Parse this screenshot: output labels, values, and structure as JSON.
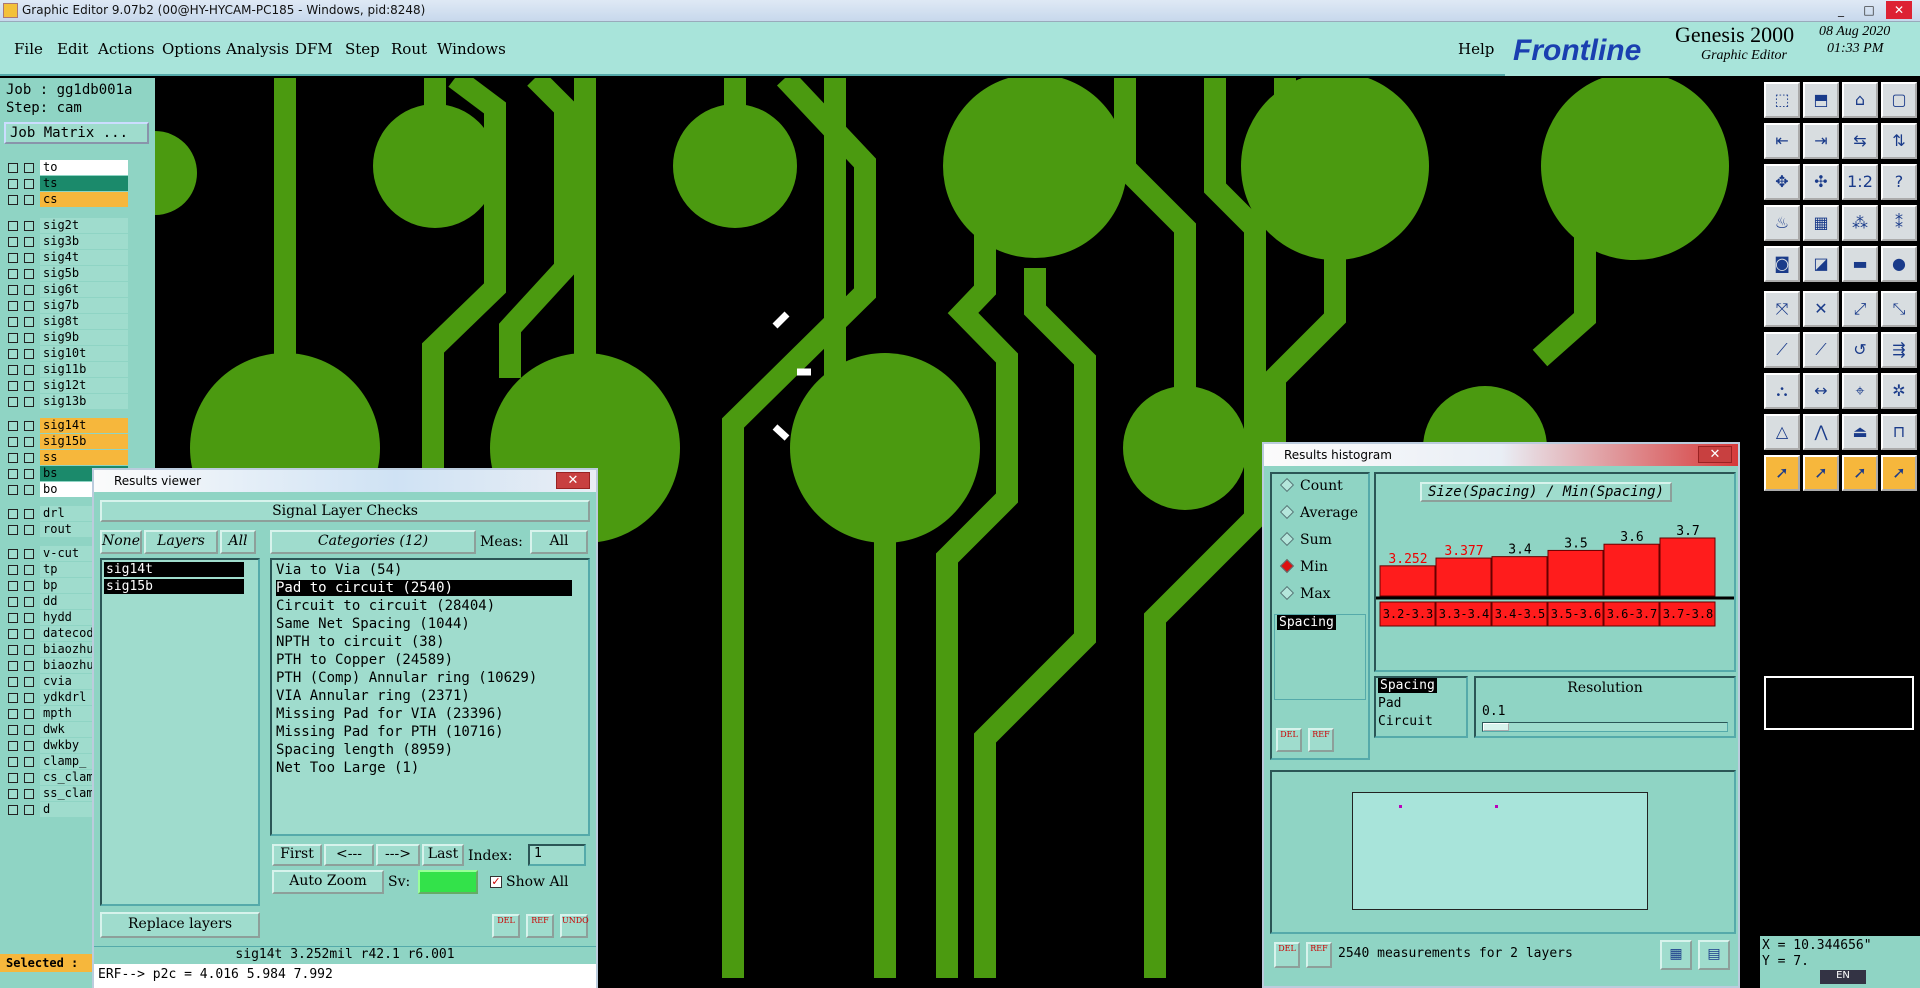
{
  "app": {
    "title": "Graphic Editor 9.07b2 (00@HY-HYCAM-PC185 - Windows, pid:8248)",
    "min": "_",
    "max": "□",
    "close": "✕"
  },
  "menu": {
    "items": [
      "File",
      "Edit",
      "Actions",
      "Options",
      "Analysis",
      "DFM",
      "Step",
      "Rout",
      "Windows"
    ],
    "help": "Help"
  },
  "brand": {
    "logo": "Frontline",
    "product": "Genesis 2000",
    "subtitle": "Graphic Editor",
    "date": "08 Aug 2020",
    "time": "01:33 PM"
  },
  "job": {
    "job_line": "Job : gg1db001a",
    "step_line": "Step: cam",
    "matrix_button": "Job Matrix ..."
  },
  "layers": [
    {
      "name": "to",
      "color": "#ffffff"
    },
    {
      "name": "ts",
      "color": "#1b8a6b"
    },
    {
      "name": "cs",
      "color": "#f6b73c"
    },
    {
      "name": "sig2t",
      "color": "#9fdccd"
    },
    {
      "name": "sig3b",
      "color": "#9fdccd"
    },
    {
      "name": "sig4t",
      "color": "#9fdccd"
    },
    {
      "name": "sig5b",
      "color": "#9fdccd"
    },
    {
      "name": "sig6t",
      "color": "#9fdccd"
    },
    {
      "name": "sig7b",
      "color": "#9fdccd"
    },
    {
      "name": "sig8t",
      "color": "#9fdccd"
    },
    {
      "name": "sig9b",
      "color": "#9fdccd"
    },
    {
      "name": "sig10t",
      "color": "#9fdccd"
    },
    {
      "name": "sig11b",
      "color": "#9fdccd"
    },
    {
      "name": "sig12t",
      "color": "#9fdccd"
    },
    {
      "name": "sig13b",
      "color": "#9fdccd"
    },
    {
      "name": "sig14t",
      "color": "#f6b73c"
    },
    {
      "name": "sig15b",
      "color": "#f6b73c"
    },
    {
      "name": "ss",
      "color": "#f6b73c"
    },
    {
      "name": "bs",
      "color": "#1b8a6b"
    },
    {
      "name": "bo",
      "color": "#ffffff"
    },
    {
      "name": "drl",
      "color": "#9fdccd"
    },
    {
      "name": "rout",
      "color": "#9fdccd"
    },
    {
      "name": "v-cut",
      "color": "#9fdccd"
    },
    {
      "name": "tp",
      "color": "#9fdccd"
    },
    {
      "name": "bp",
      "color": "#9fdccd"
    },
    {
      "name": "dd",
      "color": "#9fdccd"
    },
    {
      "name": "hydd",
      "color": "#9fdccd"
    },
    {
      "name": "datecod",
      "color": "#9fdccd"
    },
    {
      "name": "biaozhu",
      "color": "#9fdccd"
    },
    {
      "name": "biaozhu",
      "color": "#9fdccd"
    },
    {
      "name": "cvia",
      "color": "#9fdccd"
    },
    {
      "name": "ydkdrl",
      "color": "#9fdccd"
    },
    {
      "name": "mpth",
      "color": "#9fdccd"
    },
    {
      "name": "dwk",
      "color": "#9fdccd"
    },
    {
      "name": "dwkby",
      "color": "#9fdccd"
    },
    {
      "name": "clamp_",
      "color": "#9fdccd"
    },
    {
      "name": "cs_clam",
      "color": "#9fdccd"
    },
    {
      "name": "ss_clam",
      "color": "#9fdccd"
    },
    {
      "name": "d",
      "color": "#9fdccd"
    }
  ],
  "selected_label": "Selected :",
  "results_viewer": {
    "title": "Results viewer",
    "close": "✕",
    "heading": "Signal Layer Checks",
    "none": "None",
    "layers_btn": "Layers",
    "all_btn": "All",
    "layer_list": [
      "sig14t",
      "sig15b"
    ],
    "categories_label": "Categories (12)",
    "meas_label": "Meas:",
    "meas_value": "All",
    "categories": [
      "Via to Via (54)",
      "Pad to circuit (2540)",
      "Circuit to circuit (28404)",
      "Same Net Spacing (1044)",
      "NPTH to circuit (38)",
      "PTH to Copper (24589)",
      "PTH (Comp) Annular ring (10629)",
      "VIA Annular ring (2371)",
      "Missing Pad for VIA (23396)",
      "Missing Pad for PTH (10716)",
      "Spacing length (8959)",
      "Net Too Large (1)"
    ],
    "selected_category": 1,
    "first": "First",
    "prev": "<---",
    "next": "--->",
    "last": "Last",
    "index_label": "Index:",
    "index_value": "1",
    "auto_zoom": "Auto Zoom",
    "sv_label": "Sv:",
    "show_all": "Show All",
    "replace_layers": "Replace layers",
    "del": "DEL",
    "ref": "REF",
    "undo": "UNDO",
    "status": "sig14t 3.252mil  r42.1  r6.001",
    "erf": "ERF--> p2c = 4.016 5.984 7.992"
  },
  "histogram": {
    "title": "Results histogram",
    "close": "✕",
    "modes": [
      "Count",
      "Average",
      "Sum",
      "Min",
      "Max"
    ],
    "selected_mode": "Min",
    "chart_title": "Size(Spacing) / Min(Spacing)",
    "list_item": "Spacing",
    "chart_data": {
      "type": "bar",
      "categories": [
        "3.2-3.3",
        "3.3-3.4",
        "3.4-3.5",
        "3.5-3.6",
        "3.6-3.7",
        "3.7-3.8"
      ],
      "values": [
        3.252,
        3.377,
        3.4,
        3.5,
        3.6,
        3.7
      ],
      "value_labels": [
        "3.252",
        "3.377",
        "3.4",
        "3.5",
        "3.6",
        "3.7"
      ],
      "highlight": [
        0,
        1
      ],
      "bar_color": "#ff1c1c"
    },
    "field_list": [
      "Spacing",
      "Pad",
      "Circuit"
    ],
    "resolution_label": "Resolution",
    "resolution_value": "0.1",
    "del": "DEL",
    "ref": "REF",
    "footer": "2540 measurements for 2 layers"
  },
  "coords": {
    "x": "X = 10.344656\"",
    "y": "Y = 7.",
    "lang": "EN"
  }
}
